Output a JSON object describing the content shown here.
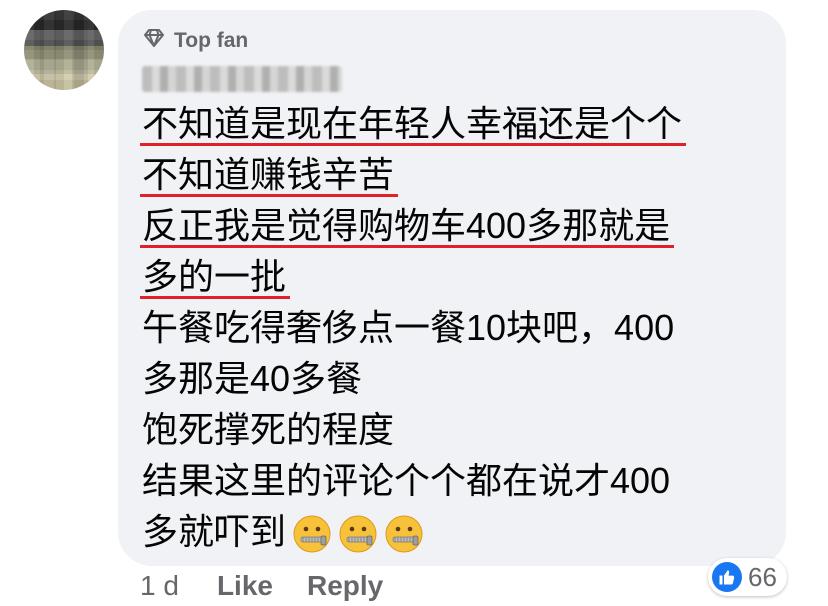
{
  "comment": {
    "badge_label": "Top fan",
    "lines": [
      "不知道是现在年轻人幸福还是个个",
      "不知道赚钱辛苦",
      "反正我是觉得购物车400多那就是",
      "多的一批",
      "午餐吃得奢侈点一餐10块吧，400",
      "多那是40多餐",
      "饱死撑死的程度",
      "结果这里的评论个个都在说才400",
      "多就吓到"
    ],
    "emojis": [
      "zipper-mouth-face-icon",
      "zipper-mouth-face-icon",
      "zipper-mouth-face-icon"
    ]
  },
  "actions": {
    "time": "1 d",
    "like_label": "Like",
    "reply_label": "Reply"
  },
  "reactions": {
    "count": "66",
    "type": "like"
  },
  "colors": {
    "bubble": "#f0f2f5",
    "underline": "#e0212a",
    "secondary_text": "#65676b",
    "like_blue": "#1877f2"
  }
}
